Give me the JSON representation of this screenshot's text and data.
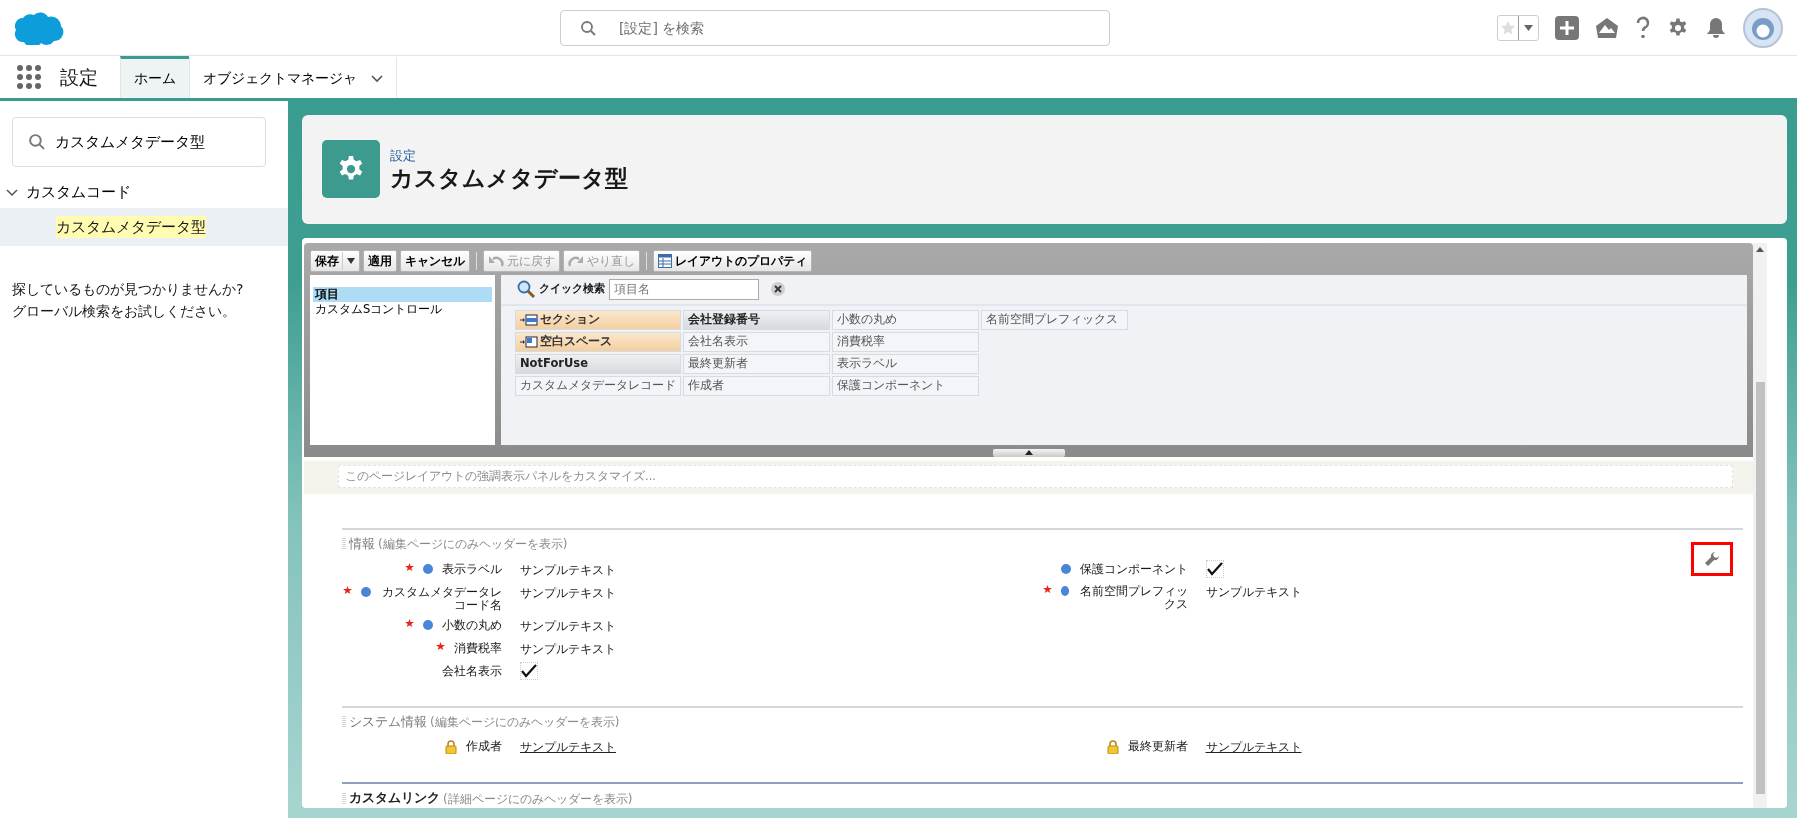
{
  "top_bar": {
    "search": {
      "placeholder": "[設定] を検索"
    }
  },
  "nav": {
    "app_name": "設定",
    "tabs": [
      {
        "label": "ホーム",
        "selected": true,
        "has_menu": false
      },
      {
        "label": "オブジェクトマネージャ",
        "selected": false,
        "has_menu": true
      }
    ]
  },
  "sidebar": {
    "search": {
      "value": "カスタムメタデータ型"
    },
    "tree": [
      {
        "label": "カスタムコード",
        "expanded": true,
        "children": [
          {
            "label": "カスタムメタデータ型",
            "selected": true
          }
        ]
      }
    ],
    "help_text": "探しているものが見つかりませんか?\nグローバル検索をお試しください。"
  },
  "page_header": {
    "breadcrumb": "設定",
    "title": "カスタムメタデータ型"
  },
  "layout_editor": {
    "toolbar": [
      {
        "label": "保存",
        "kind": "split",
        "disabled": false
      },
      {
        "label": "適用",
        "kind": "plain",
        "disabled": false
      },
      {
        "label": "キャンセル",
        "kind": "plain",
        "disabled": false
      },
      {
        "label": "元に戻す",
        "kind": "undo",
        "disabled": true
      },
      {
        "label": "やり直し",
        "kind": "redo",
        "disabled": true
      },
      {
        "label": "レイアウトのプロパティ",
        "kind": "properties",
        "disabled": false
      }
    ],
    "categories": [
      {
        "label": "項目",
        "selected": true
      },
      {
        "label": "カスタムSコントロール",
        "selected": false
      }
    ],
    "quick_find": {
      "label": "クイック検索",
      "placeholder": "項目名"
    },
    "palette_columns": [
      [
        {
          "label": "セクション",
          "kind": "section"
        },
        {
          "label": "空白スペース",
          "kind": "blank"
        },
        {
          "label": "NotForUse",
          "kind": "field",
          "in_layout": false
        },
        {
          "label": "カスタムメタデータレコード",
          "kind": "field",
          "in_layout": true
        }
      ],
      [
        {
          "label": "会社登録番号",
          "kind": "field",
          "in_layout": false
        },
        {
          "label": "会社名表示",
          "kind": "field",
          "in_layout": true
        },
        {
          "label": "最終更新者",
          "kind": "field",
          "in_layout": true
        },
        {
          "label": "作成者",
          "kind": "field",
          "in_layout": true
        }
      ],
      [
        {
          "label": "小数の丸め",
          "kind": "field",
          "in_layout": true
        },
        {
          "label": "消費税率",
          "kind": "field",
          "in_layout": true
        },
        {
          "label": "表示ラベル",
          "kind": "field",
          "in_layout": true
        },
        {
          "label": "保護コンポーネント",
          "kind": "field",
          "in_layout": true
        }
      ],
      [
        {
          "label": "名前空間プレフィックス",
          "kind": "field",
          "in_layout": true
        }
      ]
    ],
    "highlights_panel": {
      "hint": "このページレイアウトの強調表示パネルをカスタマイズ..."
    },
    "sections": [
      {
        "kind": "fields",
        "title": "情報",
        "note": "(編集ページにのみヘッダーを表示)",
        "columns": [
          [
            {
              "label": "表示ラベル",
              "required": true,
              "dot": true,
              "locked": false,
              "kind": "text",
              "value": "サンプルテキスト"
            },
            {
              "label": "カスタムメタデータレコード名",
              "required": true,
              "dot": true,
              "locked": false,
              "kind": "text",
              "value": "サンプルテキスト"
            },
            {
              "label": "小数の丸め",
              "required": true,
              "dot": true,
              "locked": false,
              "kind": "text",
              "value": "サンプルテキスト"
            },
            {
              "label": "消費税率",
              "required": true,
              "dot": false,
              "locked": false,
              "kind": "text",
              "value": "サンプルテキスト"
            },
            {
              "label": "会社名表示",
              "required": false,
              "dot": false,
              "locked": false,
              "kind": "checkbox",
              "checked": true
            }
          ],
          [
            {
              "label": "保護コンポーネント",
              "required": false,
              "dot": true,
              "locked": false,
              "kind": "checkbox",
              "checked": true
            },
            {
              "label": "名前空間プレフィックス",
              "required": true,
              "dot": true,
              "locked": false,
              "kind": "text",
              "value": "サンプルテキスト"
            }
          ]
        ]
      },
      {
        "kind": "fields",
        "title": "システム情報",
        "note": "(編集ページにのみヘッダーを表示)",
        "columns": [
          [
            {
              "label": "作成者",
              "required": false,
              "dot": false,
              "locked": true,
              "kind": "link",
              "value": "サンプルテキスト"
            }
          ],
          [
            {
              "label": "最終更新者",
              "required": false,
              "dot": false,
              "locked": true,
              "kind": "link",
              "value": "サンプルテキスト"
            }
          ]
        ]
      },
      {
        "kind": "links",
        "title": "カスタムリンク",
        "note": "(詳細ページにのみヘッダーを表示)"
      }
    ]
  }
}
